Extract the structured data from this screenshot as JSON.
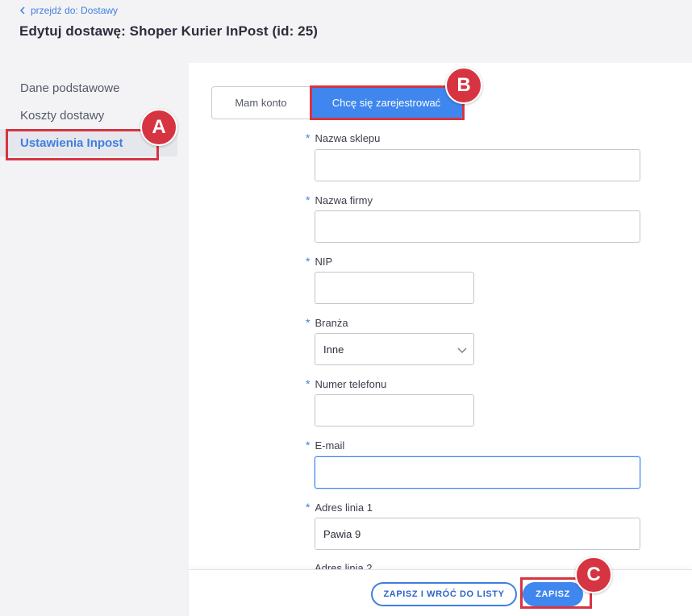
{
  "header": {
    "back_link": "przejdź do: Dostawy",
    "title": "Edytuj dostawę: Shoper Kurier InPost (id: 25)"
  },
  "sidebar": {
    "items": [
      {
        "label": "Dane podstawowe",
        "active": false
      },
      {
        "label": "Koszty dostawy",
        "active": false
      },
      {
        "label": "Ustawienia Inpost",
        "active": true
      }
    ]
  },
  "tabs": [
    {
      "label": "Mam konto",
      "active": false
    },
    {
      "label": "Chcę się zarejestrować",
      "active": true
    }
  ],
  "form": {
    "required_marker": "*",
    "fields": [
      {
        "label": "Nazwa sklepu",
        "value": ""
      },
      {
        "label": "Nazwa firmy",
        "value": ""
      },
      {
        "label": "NIP",
        "value": ""
      },
      {
        "label": "Branża",
        "value": "Inne",
        "type": "select"
      },
      {
        "label": "Numer telefonu",
        "value": ""
      },
      {
        "label": "E-mail",
        "value": "",
        "focused": true
      },
      {
        "label": "Adres linia 1",
        "value": "Pawia 9"
      },
      {
        "label": "Adres linia 2",
        "value": ""
      }
    ]
  },
  "footer": {
    "save_and_return_label": "ZAPISZ I WRÓĆ DO LISTY",
    "save_label": "ZAPISZ"
  },
  "annotations": {
    "a": "A",
    "b": "B",
    "c": "C"
  },
  "colors": {
    "accent": "#3f86ee",
    "link": "#3f7fe0",
    "highlight": "#d63441"
  }
}
